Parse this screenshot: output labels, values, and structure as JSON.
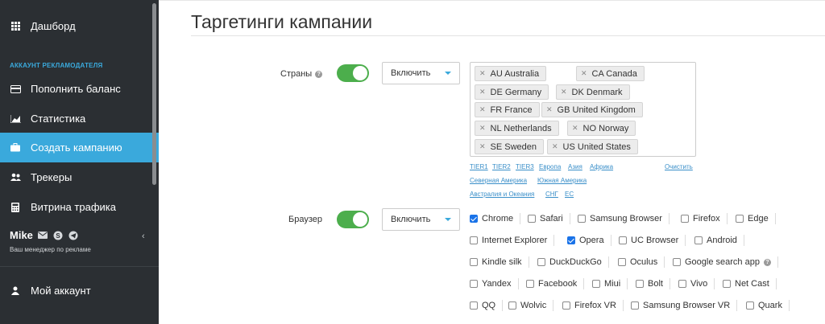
{
  "sidebar": {
    "dashboard": "Дашборд",
    "section": "АККАУНТ РЕКЛАМОДАТЕЛЯ",
    "items": [
      {
        "label": "Пополнить баланс",
        "icon": "credit-card-icon"
      },
      {
        "label": "Статистика",
        "icon": "chart-icon"
      },
      {
        "label": "Создать кампанию",
        "icon": "briefcase-icon"
      },
      {
        "label": "Трекеры",
        "icon": "users-icon"
      },
      {
        "label": "Витрина трафика",
        "icon": "calculator-icon"
      }
    ],
    "active_index": 2,
    "manager_name": "Mike",
    "manager_role": "Ваш менеджер по рекламе",
    "account": "Мой аккаунт",
    "active_color": "#3aa9dc",
    "bg_color": "#2b2f33"
  },
  "page": {
    "title": "Таргетинги кампании"
  },
  "countries": {
    "label": "Страны",
    "enabled": true,
    "mode": "Включить",
    "tags": [
      "AU Australia",
      "CA Canada",
      "DE Germany",
      "DK Denmark",
      "FR France",
      "GB United Kingdom",
      "NL Netherlands",
      "NO Norway",
      "SE Sweden",
      "US United States"
    ],
    "quick_links": [
      "TIER1",
      "TIER2",
      "TIER3",
      "Европа",
      "Азия",
      "Африка",
      "Северная Америка",
      "Южная Америка",
      "Австралия и Океания",
      "СНГ",
      "ЕС"
    ],
    "clear": "Очистить"
  },
  "browser": {
    "label": "Браузер",
    "enabled": true,
    "mode": "Включить",
    "options": [
      {
        "label": "Chrome",
        "checked": true
      },
      {
        "label": "Safari",
        "checked": false
      },
      {
        "label": "Samsung Browser",
        "checked": false
      },
      {
        "label": "Firefox",
        "checked": false
      },
      {
        "label": "Edge",
        "checked": false
      },
      {
        "label": "Internet Explorer",
        "checked": false
      },
      {
        "label": "Opera",
        "checked": true
      },
      {
        "label": "UC Browser",
        "checked": false
      },
      {
        "label": "Android",
        "checked": false
      },
      {
        "label": "Kindle silk",
        "checked": false
      },
      {
        "label": "DuckDuckGo",
        "checked": false
      },
      {
        "label": "Oculus",
        "checked": false
      },
      {
        "label": "Google search app",
        "checked": false
      },
      {
        "label": "Yandex",
        "checked": false
      },
      {
        "label": "Facebook",
        "checked": false
      },
      {
        "label": "Miui",
        "checked": false
      },
      {
        "label": "Bolt",
        "checked": false
      },
      {
        "label": "Vivo",
        "checked": false
      },
      {
        "label": "Net Cast",
        "checked": false
      },
      {
        "label": "QQ",
        "checked": false
      },
      {
        "label": "Wolvic",
        "checked": false
      },
      {
        "label": "Firefox VR",
        "checked": false
      },
      {
        "label": "Samsung Browser VR",
        "checked": false
      },
      {
        "label": "Quark",
        "checked": false
      }
    ],
    "checked_color": "#1a73e8"
  },
  "toggle_color": "#4cae4c"
}
